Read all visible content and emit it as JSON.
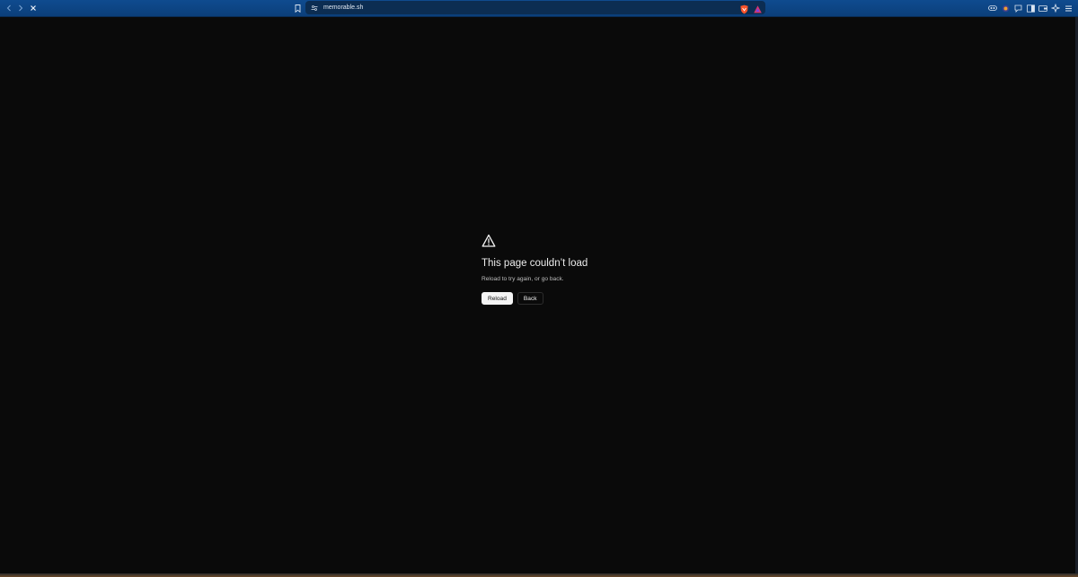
{
  "browser": {
    "url": "memorable.sh",
    "icons": {
      "back": "chevron-left-icon",
      "forward": "chevron-right-icon",
      "stop": "close-icon",
      "bookmark": "bookmark-icon",
      "site_info": "site-settings-icon",
      "shields": "brave-shield-icon",
      "rewards": "brave-rewards-icon",
      "extensions": [
        "vpn-icon",
        "wallet-icon",
        "chat-icon",
        "sidebar-icon",
        "wallet-panel-icon",
        "leo-ai-icon",
        "menu-icon"
      ]
    },
    "colors": {
      "toolbar": "#0f4b8f",
      "urlbar": "#0c2d52",
      "shield": "#fb542b"
    }
  },
  "error_page": {
    "icon": "warning-icon",
    "title": "This page couldn’t load",
    "subtitle": "Reload to try again, or go back.",
    "reload_label": "Reload",
    "back_label": "Back"
  }
}
